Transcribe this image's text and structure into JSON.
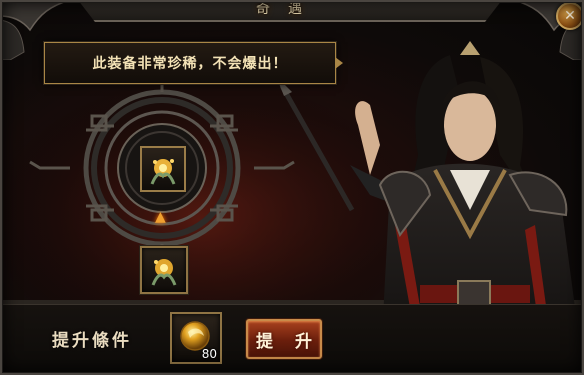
{
  "window": {
    "title": "奇遇"
  },
  "notice": {
    "text": "此装备非常珍稀，不会爆出！"
  },
  "upgrade_panel": {
    "condition_label": "提升條件",
    "material": {
      "icon": "gold-orb-icon",
      "count": "80"
    },
    "upgrade_button_label": "提 升"
  },
  "items": {
    "current_item_icon": "glowing-talisman-icon",
    "target_item_icon": "glowing-talisman-icon",
    "arrow_icon": "up-arrow-icon"
  },
  "colors": {
    "accent_gold": "#a98646",
    "button_red": "#8a2c12",
    "text_cream": "#f3e2b6"
  }
}
